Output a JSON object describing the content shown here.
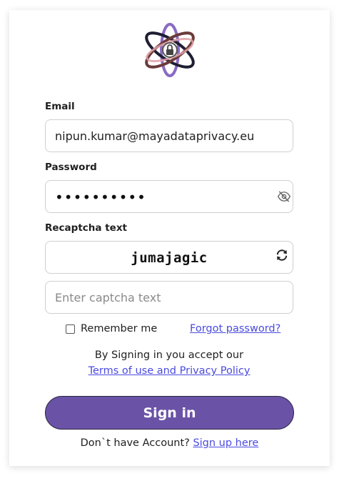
{
  "form": {
    "email_label": "Email",
    "email_value": "nipun.kumar@mayadataprivacy.eu",
    "password_label": "Password",
    "password_value": "••••••••••",
    "captcha_label": "Recaptcha text",
    "captcha_word": "jumajagic",
    "captcha_placeholder": "Enter captcha text",
    "remember_label": "Remember me",
    "forgot_link": "Forgot password?",
    "terms_prefix": "By Signing in you accept our",
    "terms_link": "Terms of use and Privacy Policy",
    "signin_label": "Sign in",
    "signup_prefix": "Don`t have Account?",
    "signup_link": "Sign up here"
  },
  "icons": {
    "logo": "atom-lock-logo",
    "password_toggle": "eye-slash-icon",
    "captcha_refresh": "refresh-icon"
  },
  "colors": {
    "primary": "#6a53a6",
    "link": "#4a4adf"
  }
}
